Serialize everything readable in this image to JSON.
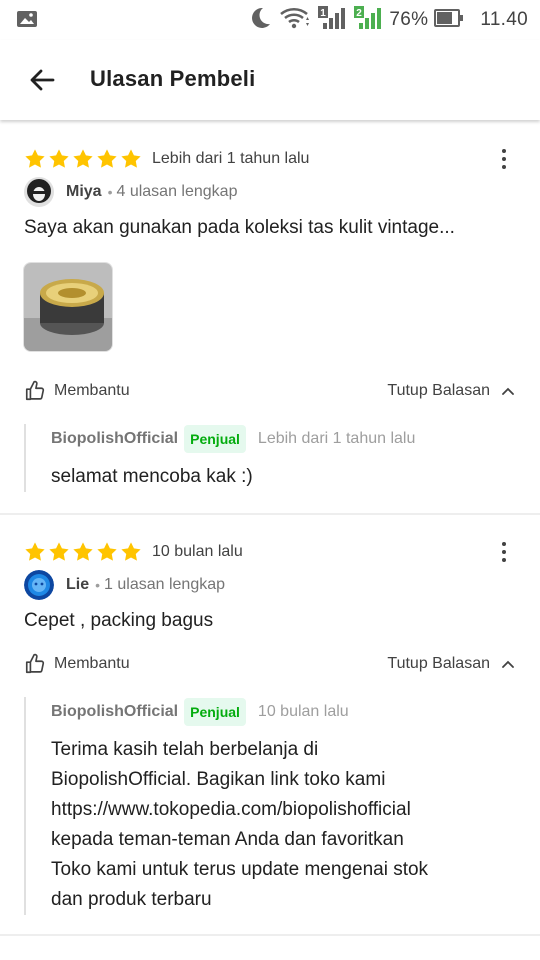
{
  "status_bar": {
    "battery_percent": "76%",
    "time": "11.40",
    "sim1_label": "1",
    "sim2_label": "2"
  },
  "header": {
    "title": "Ulasan Pembeli"
  },
  "reviews": [
    {
      "rating": 5,
      "date": "Lebih dari 1 tahun lalu",
      "user_name": "Miya",
      "review_count": "4 ulasan lengkap",
      "text": "Saya akan gunakan pada koleksi tas kulit vintage...",
      "has_photo": true,
      "helpful_label": "Membantu",
      "close_reply_label": "Tutup Balasan",
      "reply": {
        "seller_name": "BiopolishOfficial",
        "seller_badge": "Penjual",
        "date": "Lebih dari 1 tahun lalu",
        "text": "selamat mencoba kak :)"
      }
    },
    {
      "rating": 5,
      "date": "10 bulan lalu",
      "user_name": "Lie",
      "review_count": "1 ulasan lengkap",
      "text": "Cepet , packing bagus",
      "has_photo": false,
      "helpful_label": "Membantu",
      "close_reply_label": "Tutup Balasan",
      "reply": {
        "seller_name": "BiopolishOfficial",
        "seller_badge": "Penjual",
        "date": "10 bulan lalu",
        "text_lines": [
          "Terima kasih telah berbelanja di",
          "BiopolishOfficial. Bagikan link toko kami",
          "https://www.tokopedia.com/biopolishofficial",
          "kepada teman-teman Anda dan favoritkan",
          "Toko kami untuk terus update mengenai stok",
          "dan produk terbaru"
        ]
      }
    }
  ],
  "colors": {
    "star": "#ffc400",
    "seller_badge_bg": "#e5f9ee",
    "seller_badge_text": "#03ac0e",
    "signal_green": "#4caf50"
  }
}
